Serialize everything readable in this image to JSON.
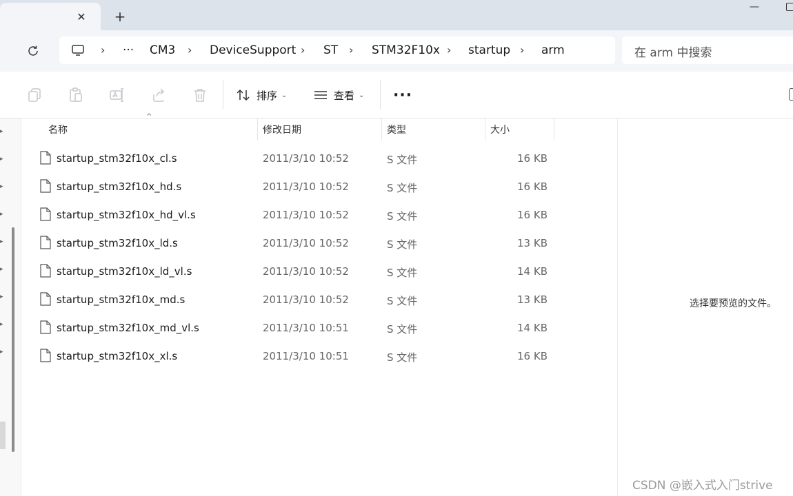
{
  "tab": {
    "close_glyph": "✕",
    "new_glyph": "+"
  },
  "window": {
    "minimize_glyph": "—"
  },
  "address": {
    "crumbs": [
      "CM3",
      "DeviceSupport",
      "ST",
      "STM32F10x",
      "startup",
      "arm"
    ],
    "overflow": "···",
    "separator": "›"
  },
  "search": {
    "placeholder": "在 arm 中搜索"
  },
  "toolbar": {
    "icons": [
      "copy-icon",
      "paste-icon",
      "rename-icon",
      "share-icon",
      "delete-icon"
    ],
    "sort_label": "排序",
    "view_label": "查看",
    "more_label": "···",
    "chevron": "⌄"
  },
  "columns": {
    "name": "名称",
    "date": "修改日期",
    "type": "类型",
    "size": "大小"
  },
  "files": [
    {
      "name": "startup_stm32f10x_cl.s",
      "date": "2011/3/10 10:52",
      "type": "S 文件",
      "size": "16 KB"
    },
    {
      "name": "startup_stm32f10x_hd.s",
      "date": "2011/3/10 10:52",
      "type": "S 文件",
      "size": "16 KB"
    },
    {
      "name": "startup_stm32f10x_hd_vl.s",
      "date": "2011/3/10 10:52",
      "type": "S 文件",
      "size": "16 KB"
    },
    {
      "name": "startup_stm32f10x_ld.s",
      "date": "2011/3/10 10:52",
      "type": "S 文件",
      "size": "13 KB"
    },
    {
      "name": "startup_stm32f10x_ld_vl.s",
      "date": "2011/3/10 10:52",
      "type": "S 文件",
      "size": "14 KB"
    },
    {
      "name": "startup_stm32f10x_md.s",
      "date": "2011/3/10 10:52",
      "type": "S 文件",
      "size": "13 KB"
    },
    {
      "name": "startup_stm32f10x_md_vl.s",
      "date": "2011/3/10 10:51",
      "type": "S 文件",
      "size": "14 KB"
    },
    {
      "name": "startup_stm32f10x_xl.s",
      "date": "2011/3/10 10:51",
      "type": "S 文件",
      "size": "16 KB"
    }
  ],
  "preview": {
    "text": "选择要预览的文件。"
  },
  "watermark": "CSDN @嵌入式入门strive"
}
